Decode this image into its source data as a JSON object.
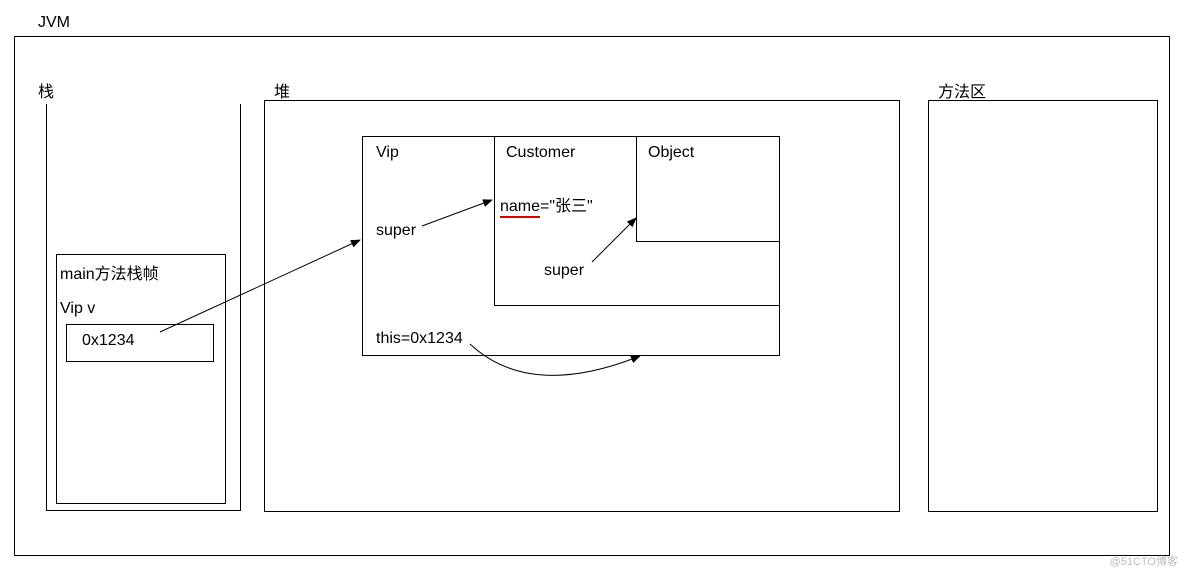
{
  "labels": {
    "jvm": "JVM",
    "stack": "栈",
    "heap": "堆",
    "method_area": "方法区",
    "main_frame": "main方法栈帧",
    "vip_var": "Vip v",
    "address": "0x1234",
    "vip_box": "Vip",
    "customer_box": "Customer",
    "object_box": "Object",
    "name_label": "name",
    "name_value": "=\"张三\"",
    "super1": "super",
    "super2": "super",
    "this_ptr": "this=0x1234"
  },
  "watermark": "@51CTO博客"
}
